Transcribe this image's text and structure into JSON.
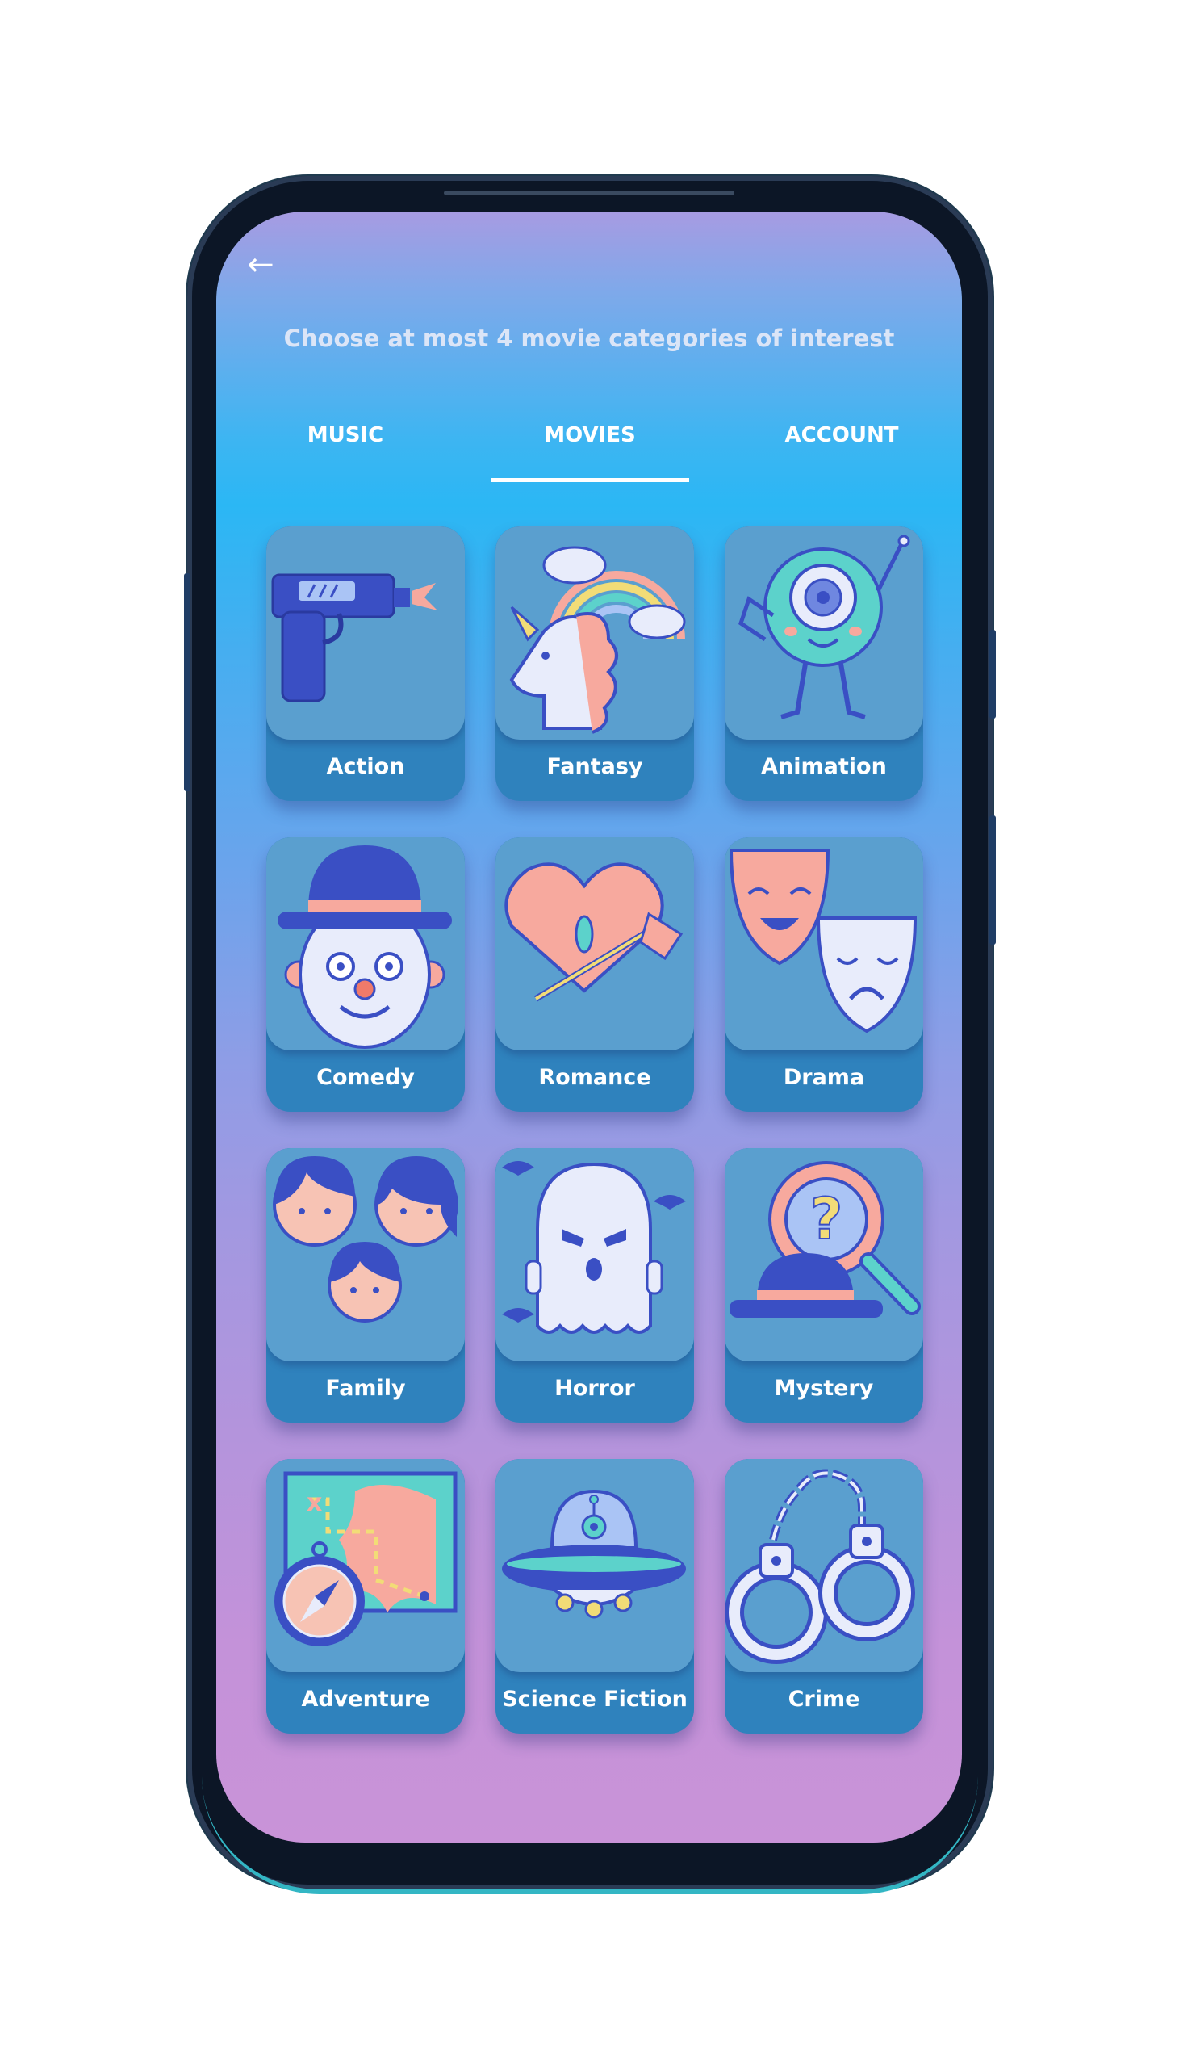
{
  "header": {
    "back_icon": "arrow-left-icon",
    "back_glyph": "←",
    "subtitle": "Choose at most 4 movie categories of interest"
  },
  "tabs": [
    {
      "label": "MUSIC",
      "active": false
    },
    {
      "label": "MOVIES",
      "active": true
    },
    {
      "label": "ACCOUNT",
      "active": false
    }
  ],
  "categories": [
    {
      "label": "Action",
      "icon": "gun-icon"
    },
    {
      "label": "Fantasy",
      "icon": "unicorn-rainbow-icon"
    },
    {
      "label": "Animation",
      "icon": "cyclops-monster-icon"
    },
    {
      "label": "Comedy",
      "icon": "clown-icon"
    },
    {
      "label": "Romance",
      "icon": "heart-arrow-icon"
    },
    {
      "label": "Drama",
      "icon": "theater-masks-icon"
    },
    {
      "label": "Family",
      "icon": "family-faces-icon"
    },
    {
      "label": "Horror",
      "icon": "ghost-icon"
    },
    {
      "label": "Mystery",
      "icon": "magnifier-hat-icon"
    },
    {
      "label": "Adventure",
      "icon": "map-compass-icon"
    },
    {
      "label": "Science Fiction",
      "icon": "ufo-icon"
    },
    {
      "label": "Crime",
      "icon": "handcuffs-icon"
    }
  ],
  "colors": {
    "gradient_top": "#a79be2",
    "gradient_mid": "#2bb7f4",
    "gradient_bottom": "#c993d8",
    "card_face": "#5a9fcf",
    "card_base": "#2f82bd",
    "icon_outline": "#3a4fc4",
    "icon_pink": "#f7a99e",
    "icon_light": "#e8ecfb",
    "icon_teal": "#5cd2cb"
  }
}
